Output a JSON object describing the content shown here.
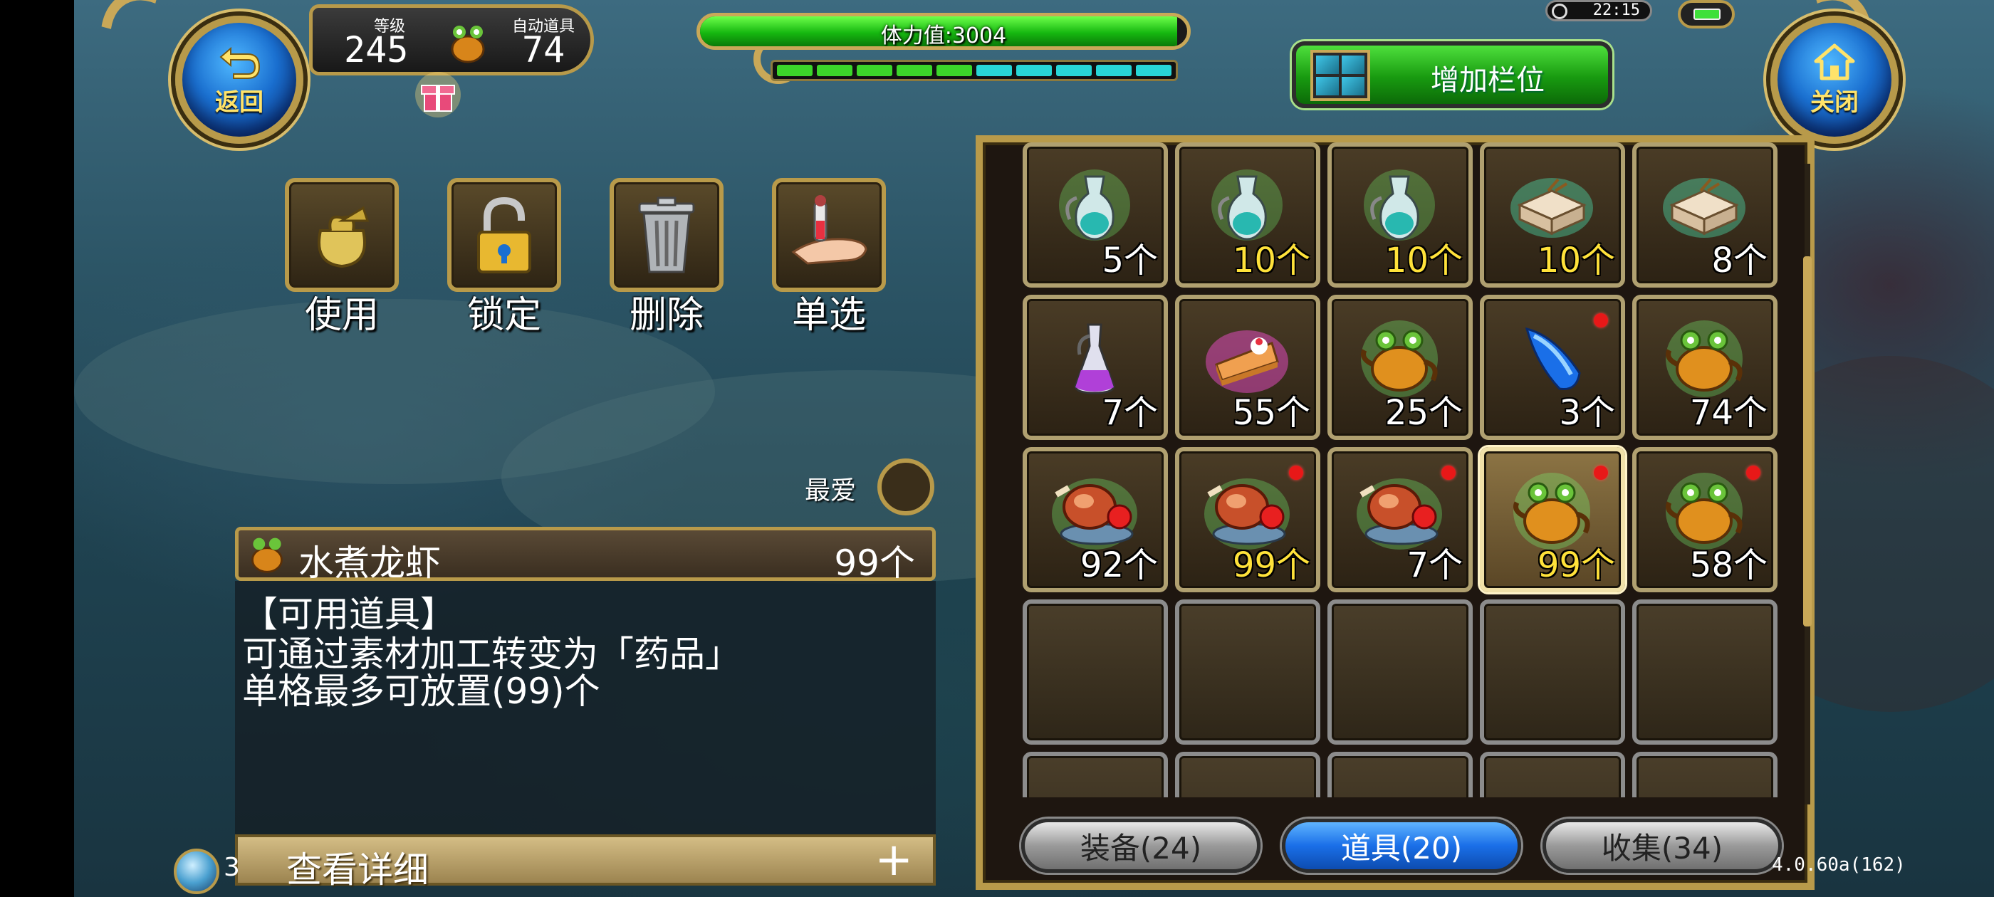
{
  "header": {
    "back_label": "返回",
    "close_label": "关闭",
    "level_caption": "等级",
    "level_value": "245",
    "auto_item_caption": "自动道具",
    "auto_item_value": "74",
    "stamina_text": "体力值:3004",
    "stamina_fraction": 0.98,
    "segments": [
      "#3cd62a",
      "#3cd62a",
      "#3cd62a",
      "#3cd62a",
      "#3cd62a",
      "#28d6d6",
      "#28d6d6",
      "#28d6d6",
      "#28d6d6",
      "#28d6d6"
    ],
    "add_slot_label": "增加栏位",
    "clock": "22:15"
  },
  "actions": [
    {
      "label": "使用",
      "icon": "bag-icon"
    },
    {
      "label": "锁定",
      "icon": "padlock-icon"
    },
    {
      "label": "删除",
      "icon": "trash-icon"
    },
    {
      "label": "单选",
      "icon": "hand-potion-icon"
    }
  ],
  "favorite_label": "最爱",
  "item": {
    "name": "水煮龙虾",
    "count": "99个",
    "desc_lines": [
      "【可用道具】",
      "可通过素材加工转变为「药品」",
      "单格最多可放置(99)个"
    ],
    "detail_label": "查看详细",
    "detail_plus": "+"
  },
  "bottom_left_num": "3",
  "inventory": {
    "slots": [
      {
        "icon": "teal-potion-icon",
        "qty": "5个",
        "full": false,
        "dot": false
      },
      {
        "icon": "teal-potion-icon",
        "qty": "10个",
        "full": true,
        "dot": false
      },
      {
        "icon": "teal-potion-icon",
        "qty": "10个",
        "full": true,
        "dot": false
      },
      {
        "icon": "supply-box-icon",
        "qty": "10个",
        "full": true,
        "dot": false
      },
      {
        "icon": "supply-box-icon",
        "qty": "8个",
        "full": false,
        "dot": false
      },
      {
        "icon": "purple-potion-icon",
        "qty": "7个",
        "full": false,
        "dot": false
      },
      {
        "icon": "cake-slice-icon",
        "qty": "55个",
        "full": false,
        "dot": false
      },
      {
        "icon": "teapot-icon",
        "qty": "25个",
        "full": false,
        "dot": false
      },
      {
        "icon": "blue-crystal-icon",
        "qty": "3个",
        "full": false,
        "dot": true
      },
      {
        "icon": "teapot-icon",
        "qty": "74个",
        "full": false,
        "dot": false
      },
      {
        "icon": "meat-platter-icon",
        "qty": "92个",
        "full": false,
        "dot": false
      },
      {
        "icon": "meat-platter-icon",
        "qty": "99个",
        "full": true,
        "dot": true
      },
      {
        "icon": "meat-platter-icon",
        "qty": "7个",
        "full": false,
        "dot": true
      },
      {
        "icon": "teapot-icon",
        "qty": "99个",
        "full": true,
        "dot": true,
        "selected": true
      },
      {
        "icon": "teapot-icon",
        "qty": "58个",
        "full": false,
        "dot": true
      }
    ],
    "empty_slots": 10
  },
  "tabs": [
    {
      "label": "装备(24)",
      "active": false
    },
    {
      "label": "道具(20)",
      "active": true
    },
    {
      "label": "收集(34)",
      "active": false
    }
  ],
  "version": "4.0.60a(162)"
}
